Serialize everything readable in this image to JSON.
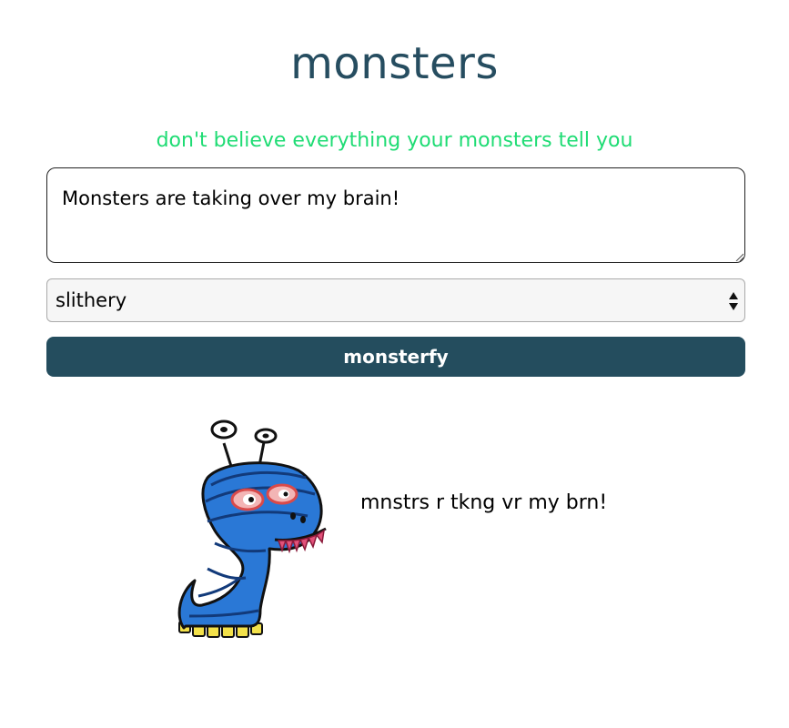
{
  "header": {
    "title": "monsters",
    "tagline": "don't believe everything your monsters tell you"
  },
  "form": {
    "message_value": "Monsters are taking over my brain!",
    "monster_type_selected": "slithery",
    "submit_label": "monsterfy"
  },
  "result": {
    "monster_icon": "slithery-monster-icon",
    "text": "mnstrs r tkng vr my brn!"
  },
  "colors": {
    "title": "#264d60",
    "tagline": "#1fdc74",
    "button_bg": "#244d5e",
    "button_text": "#ffffff",
    "monster_body": "#2a78d6",
    "monster_feet": "#f3e14a",
    "monster_teeth": "#e2517a"
  }
}
